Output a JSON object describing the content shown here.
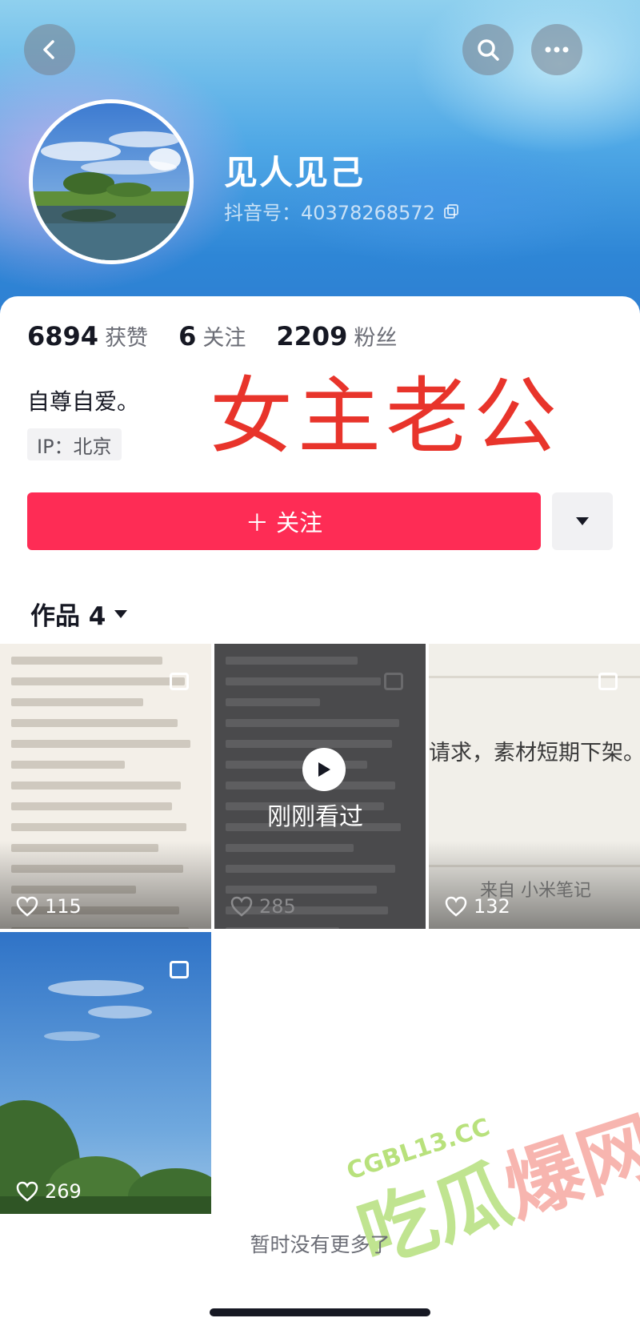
{
  "header": {
    "back_icon": "chevron-left-icon",
    "search_icon": "search-icon",
    "more_icon": "ellipsis-icon",
    "username": "见人见己",
    "douyin_id_label": "抖音号：40378268572",
    "copy_icon": "copy-icon"
  },
  "stats": [
    {
      "value": "6894",
      "label": "获赞"
    },
    {
      "value": "6",
      "label": "关注"
    },
    {
      "value": "2209",
      "label": "粉丝"
    }
  ],
  "profile": {
    "bio": "自尊自爱。",
    "ip": "IP：北京"
  },
  "overlay_text": "女主老公",
  "actions": {
    "follow_label": "＋ 关注",
    "dropdown_icon": "caret-down-icon"
  },
  "works_tab": {
    "label": "作品 4",
    "caret_icon": "caret-down-icon"
  },
  "works": [
    {
      "likes": "115"
    },
    {
      "likes": "285",
      "status": "刚刚看过"
    },
    {
      "likes": "132",
      "banner_text": "请求，素材短期下架。",
      "source": "来自 小米笔记"
    },
    {
      "likes": "269"
    }
  ],
  "footer": {
    "no_more": "暂时没有更多了"
  },
  "watermark": {
    "url": "CGBL13.CC",
    "text_a": "吃瓜",
    "text_b": "爆网"
  },
  "colors": {
    "brand_red": "#fe2c55",
    "overlay_red": "#e8342b",
    "text_primary": "#161823"
  }
}
